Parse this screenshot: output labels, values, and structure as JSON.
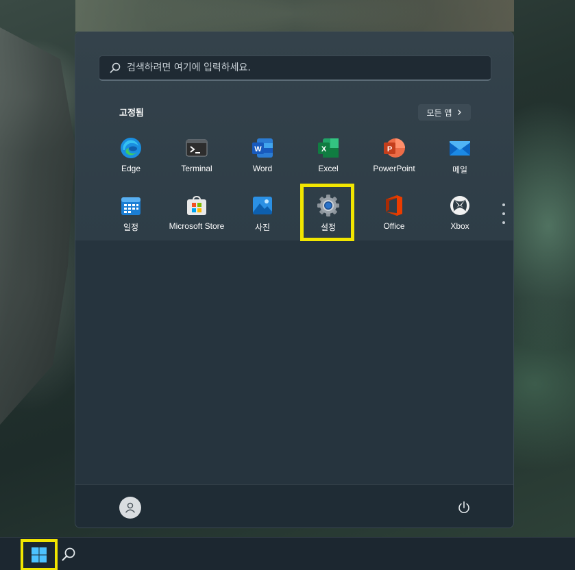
{
  "search": {
    "placeholder": "검색하려면 여기에 입력하세요."
  },
  "pinned": {
    "title": "고정됨",
    "all_apps_label": "모든 앱",
    "apps": [
      {
        "label": "Edge",
        "icon": "edge-icon"
      },
      {
        "label": "Terminal",
        "icon": "terminal-icon"
      },
      {
        "label": "Word",
        "icon": "word-icon"
      },
      {
        "label": "Excel",
        "icon": "excel-icon"
      },
      {
        "label": "PowerPoint",
        "icon": "powerpoint-icon"
      },
      {
        "label": "메일",
        "icon": "mail-icon"
      },
      {
        "label": "일정",
        "icon": "calendar-icon"
      },
      {
        "label": "Microsoft Store",
        "icon": "store-icon"
      },
      {
        "label": "사진",
        "icon": "photos-icon"
      },
      {
        "label": "설정",
        "icon": "settings-gear-icon"
      },
      {
        "label": "Office",
        "icon": "office-icon"
      },
      {
        "label": "Xbox",
        "icon": "xbox-icon"
      }
    ]
  },
  "footer": {
    "user_icon": "user-avatar-icon",
    "power_icon": "power-icon"
  },
  "taskbar": {
    "start_icon": "windows-logo-icon",
    "search_icon": "search-icon"
  },
  "colors": {
    "highlight": "#f2e600",
    "menu_bg": "#26343e",
    "taskbar_bg": "#1c2730"
  }
}
